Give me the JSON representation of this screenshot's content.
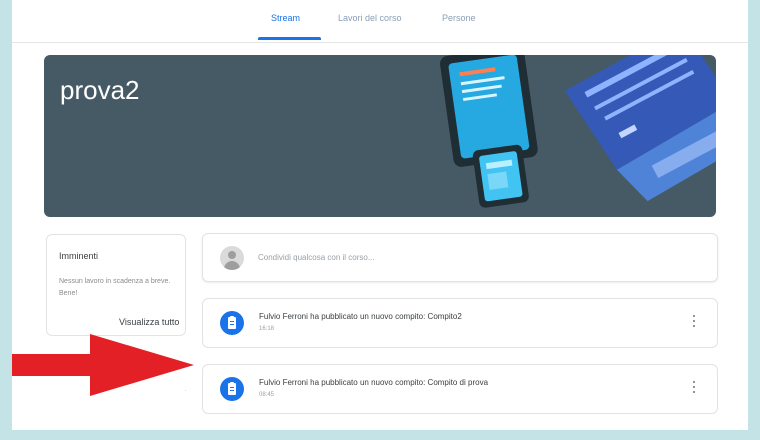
{
  "tabs": [
    {
      "label": "Stream"
    },
    {
      "label": "Lavori del corso"
    },
    {
      "label": "Persone"
    }
  ],
  "course": {
    "title": "prova2"
  },
  "upcoming": {
    "title": "Imminenti",
    "text": "Nessun lavoro in scadenza a breve. Bene!",
    "link": "Visualizza tutto"
  },
  "composer": {
    "placeholder": "Condividi qualcosa con il corso..."
  },
  "stream": [
    {
      "title": "Fulvio Ferroni ha pubblicato un nuovo compito: Compito2",
      "time": "16:18"
    },
    {
      "title": "Fulvio Ferroni ha pubblicato un nuovo compito: Compito di prova",
      "time": "08:45"
    }
  ],
  "colors": {
    "accent": "#1a73e8",
    "banner": "#465a66",
    "frame": "#c3e3e6",
    "arrow": "#e32026"
  },
  "icons": {
    "avatar": "avatar-icon",
    "assignment": "assignment-icon",
    "more": "more-vert-icon",
    "arrow": "red-arrow-icon"
  }
}
